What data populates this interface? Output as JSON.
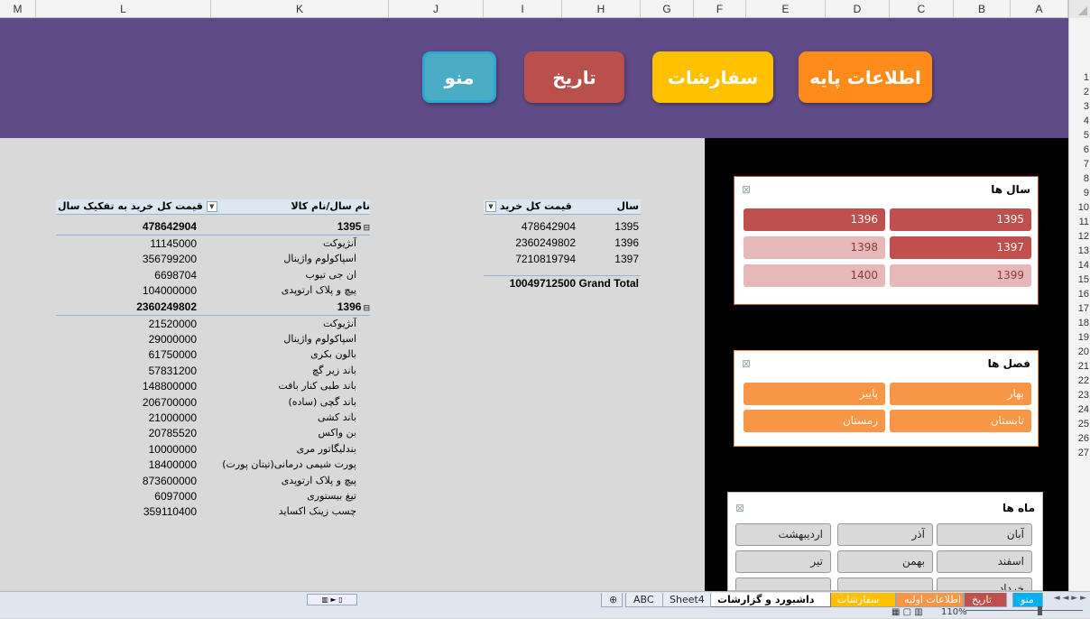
{
  "columns": [
    "M",
    "L",
    "K",
    "J",
    "I",
    "H",
    "G",
    "F",
    "E",
    "D",
    "C",
    "B",
    "A"
  ],
  "rows": [
    "1",
    "2",
    "3",
    "4",
    "5",
    "6",
    "7",
    "8",
    "9",
    "10",
    "11",
    "12",
    "13",
    "14",
    "15",
    "16",
    "17",
    "18",
    "19",
    "20",
    "21",
    "22",
    "23",
    "24",
    "25",
    "26",
    "27"
  ],
  "nav": {
    "menu": "منو",
    "history": "تاریخ",
    "orders": "سفارشات",
    "base_info": "اطلاعات پایه"
  },
  "slicers": {
    "years": {
      "title": "سال ها",
      "items": [
        "1396",
        "1395",
        "1398",
        "1397",
        "1400",
        "1399"
      ]
    },
    "seasons": {
      "title": "فصل ها",
      "items": [
        "پاییز",
        "بهار",
        "زمستان",
        "تابستان"
      ]
    },
    "months": {
      "title": "ماه ها",
      "items": [
        "اردیبهشت",
        "آذر",
        "آبان",
        "تیر",
        "بهمن",
        "اسفند",
        "",
        "",
        "خرداد"
      ]
    }
  },
  "pivot1": {
    "header_value": "قیمت کل خرید",
    "header_label": "سال",
    "rows": [
      {
        "value": "478642904",
        "label": "1395"
      },
      {
        "value": "2360249802",
        "label": "1396"
      },
      {
        "value": "7210819794",
        "label": "1397"
      }
    ],
    "total": {
      "value": "10049712500",
      "label": "Grand Total"
    }
  },
  "pivot2": {
    "header_value": "قیمت کل خرید به تفکیک سال",
    "header_label": "نام سال/نام کالا",
    "rows": [
      {
        "value": "478642904",
        "label": "1395",
        "group": true
      },
      {
        "value": "11145000",
        "label": "آنژیوکت"
      },
      {
        "value": "356799200",
        "label": "اسپاکولوم واژینال"
      },
      {
        "value": "6698704",
        "label": "ان جی تیوب"
      },
      {
        "value": "104000000",
        "label": "پیچ و پلاک ارتوپدی"
      },
      {
        "value": "2360249802",
        "label": "1396",
        "group": true
      },
      {
        "value": "21520000",
        "label": "آنژیوکت"
      },
      {
        "value": "29000000",
        "label": "اسپاکولوم واژینال"
      },
      {
        "value": "61750000",
        "label": "بالون بکری"
      },
      {
        "value": "57831200",
        "label": "باند زیر گچ"
      },
      {
        "value": "148800000",
        "label": "باند طبی کنار بافت"
      },
      {
        "value": "206700000",
        "label": "باند گچی (ساده)"
      },
      {
        "value": "21000000",
        "label": "باند کشی"
      },
      {
        "value": "20785520",
        "label": "بن واکس"
      },
      {
        "value": "10000000",
        "label": "بندلیگاتور مری"
      },
      {
        "value": "18400000",
        "label": "پورت شیمی درمانی(تیتان پورت)"
      },
      {
        "value": "873600000",
        "label": "پیچ و پلاک ارتوپدی"
      },
      {
        "value": "6097000",
        "label": "تیغ بیستوری"
      },
      {
        "value": "359110400",
        "label": "چسب زینک اکساید"
      }
    ]
  },
  "tabs": [
    {
      "label": "منو",
      "active": false,
      "color": "#00b0f0"
    },
    {
      "label": "تاریخ",
      "active": false,
      "color": "#c0504d"
    },
    {
      "label": "اطلاعات اولیه",
      "active": false,
      "color": "#f79646"
    },
    {
      "label": "سفارشات",
      "active": false,
      "color": "#ffc000"
    },
    {
      "label": "داشبورد و گزارشات",
      "active": true,
      "color": "#ffffff"
    },
    {
      "label": "Sheet4",
      "active": false,
      "color": "#e8edf3"
    },
    {
      "label": "ABC",
      "active": false,
      "color": "#e8edf3"
    }
  ],
  "status": {
    "zoom": "110%"
  },
  "colors": {
    "banner": "#5f4b87",
    "menu_btn": "#4bacc6",
    "history_btn": "#b9504c",
    "orders_btn": "#ffc000",
    "base_btn": "#ff8c1a",
    "year_slicer_dark": "#c0504d",
    "year_slicer_light": "#e6b8b7",
    "season": "#f79646",
    "month": "#d9d9d9"
  }
}
